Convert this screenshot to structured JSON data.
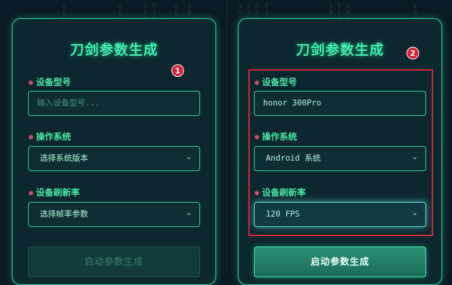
{
  "matrix_columns": [
    {
      "text": "1\n1\n0"
    },
    {
      "text": "0\n1\n1"
    },
    {
      "text": "1 0\n0 1\n1 0"
    },
    {
      "text": "0\n1\n0"
    },
    {
      "text": "1\n0\n1"
    },
    {
      "text": "1 1 0\n0 1 1\n1 0 1"
    },
    {
      "text": "0\n1\n1"
    },
    {
      "text": "1 0 1\n0 1 0\n1 1 0"
    },
    {
      "text": "1\n0\n1"
    }
  ],
  "panels": {
    "left": {
      "title": "刀剑参数生成",
      "badge": "1",
      "device_model": {
        "label": "设备型号",
        "value": "",
        "placeholder": "输入设备型号..."
      },
      "os": {
        "label": "操作系统",
        "value": "选择系统版本"
      },
      "refresh": {
        "label": "设备刷新率",
        "value": "选择帧率参数"
      },
      "button": {
        "label": "启动参数生成",
        "state": "disabled"
      }
    },
    "right": {
      "title": "刀剑参数生成",
      "badge": "2",
      "device_model": {
        "label": "设备型号",
        "value": "honor 300Pro"
      },
      "os": {
        "label": "操作系统",
        "value": "Android 系统"
      },
      "refresh": {
        "label": "设备刷新率",
        "value": "120 FPS"
      },
      "button": {
        "label": "启动参数生成",
        "state": "active"
      }
    }
  },
  "icons": {
    "chevron": "chevron-down-icon",
    "required": "asterisk"
  },
  "colors": {
    "accent": "#3df1b0",
    "highlight_box": "#d42a3c",
    "badge": "#d6243a"
  }
}
